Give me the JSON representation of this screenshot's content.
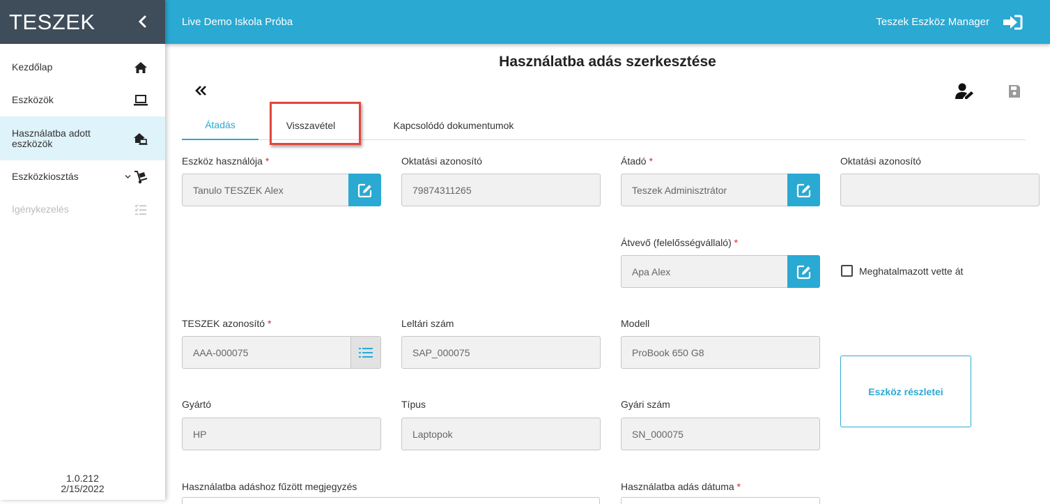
{
  "app": {
    "brand": "TESZEK",
    "version": "1.0.212",
    "build_date": "2/15/2022"
  },
  "sidebar": {
    "items": [
      {
        "label": "Kezdőlap",
        "icon": "home-icon"
      },
      {
        "label": "Eszközök",
        "icon": "laptop-icon"
      },
      {
        "label": "Használatba adott eszközök",
        "icon": "house-laptop-icon"
      },
      {
        "label": "Eszközkiosztás",
        "icon": "dolly-icon"
      },
      {
        "label": "Igénykezelés",
        "icon": "checklist-icon"
      }
    ]
  },
  "header": {
    "school": "Live Demo Iskola Próba",
    "app_name": "Teszek Eszköz Manager"
  },
  "page": {
    "title": "Használatba adás szerkesztése"
  },
  "tabs": [
    {
      "label": "Átadás",
      "active": true
    },
    {
      "label": "Visszavétel",
      "active": false
    },
    {
      "label": "Kapcsolódó dokumentumok",
      "active": false
    }
  ],
  "form": {
    "user": {
      "label": "Eszköz használója",
      "value": "Tanulo TESZEK Alex"
    },
    "user_edu_id": {
      "label": "Oktatási azonosító",
      "value": "79874311265"
    },
    "giver": {
      "label": "Átadó",
      "value": "Teszek Adminisztrátor"
    },
    "giver_edu_id": {
      "label": "Oktatási azonosító",
      "value": ""
    },
    "receiver": {
      "label": "Átvevő (felelősségvállaló)",
      "value": "Apa Alex"
    },
    "proxy_checkbox": {
      "label": "Meghatalmazott vette át",
      "checked": false
    },
    "teszek_id": {
      "label": "TESZEK azonosító",
      "value": "AAA-000075"
    },
    "inventory_no": {
      "label": "Leltári szám",
      "value": "SAP_000075"
    },
    "model": {
      "label": "Modell",
      "value": "ProBook 650 G8"
    },
    "manufacturer": {
      "label": "Gyártó",
      "value": "HP"
    },
    "type": {
      "label": "Típus",
      "value": "Laptopok"
    },
    "serial_no": {
      "label": "Gyári szám",
      "value": "SN_000075"
    },
    "details_button": "Eszköz részletei",
    "note": {
      "label": "Használatba adáshoz fűzött megjegyzés"
    },
    "date": {
      "label": "Használatba adás dátuma"
    },
    "required_mark": "*"
  },
  "colors": {
    "accent": "#2aa9d2",
    "brand_bg": "#3f4d5a",
    "required": "#d9262c",
    "highlight": "#e0473c"
  }
}
